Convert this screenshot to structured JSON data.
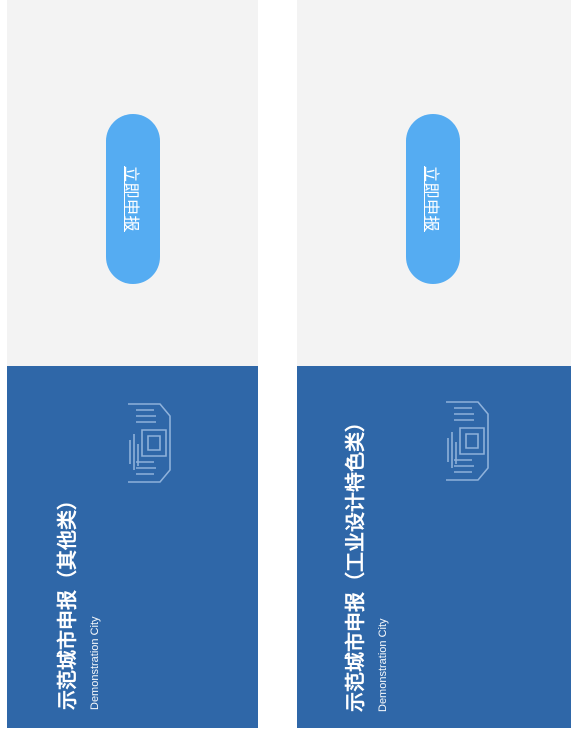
{
  "cards": [
    {
      "title": "示范城市申报（其他类）",
      "subtitle": "Demonstration City",
      "button_label": "立即申报",
      "icon": "city-building-icon"
    },
    {
      "title": "示范城市申报（工业设计特色类）",
      "subtitle": "Demonstration City",
      "button_label": "立即申报",
      "icon": "city-building-icon"
    }
  ],
  "colors": {
    "card_top_bg": "#f3f3f3",
    "card_bottom_bg": "#2f67a8",
    "button_bg": "#55acf2"
  }
}
